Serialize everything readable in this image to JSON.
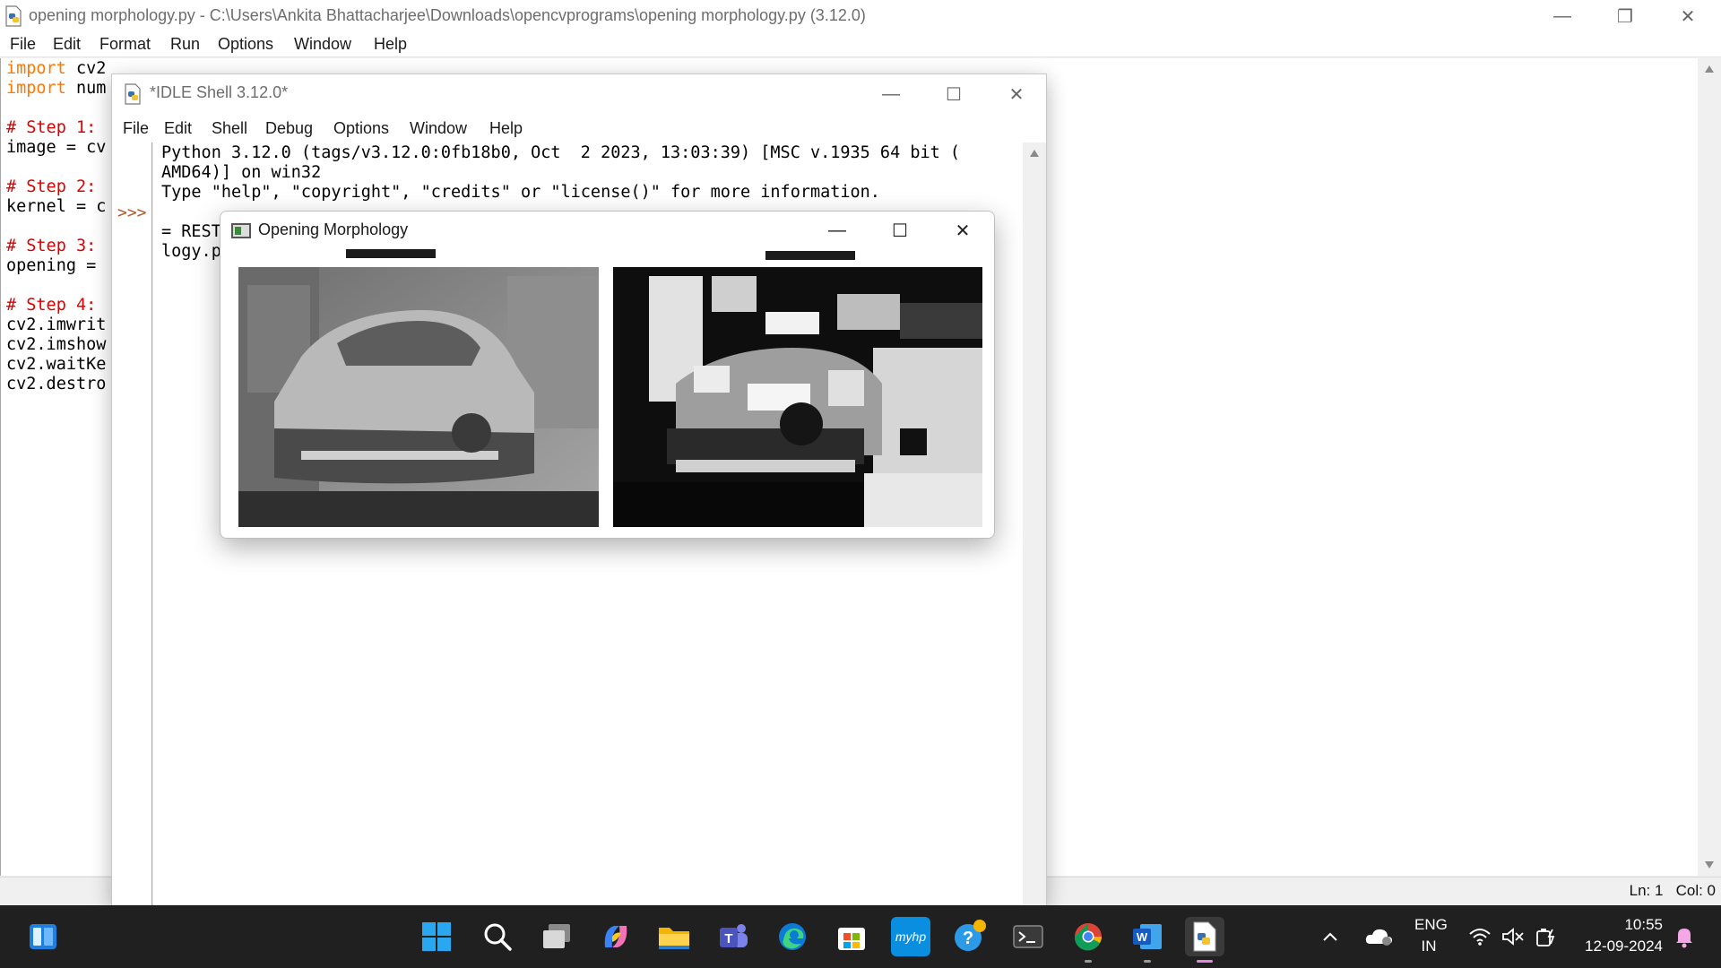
{
  "editor": {
    "title": "opening morphology.py - C:\\Users\\Ankita Bhattacharjee\\Downloads\\opencvprograms\\opening morphology.py (3.12.0)",
    "menu": [
      "File",
      "Edit",
      "Format",
      "Run",
      "Options",
      "Window",
      "Help"
    ],
    "code_lines": [
      {
        "kw": "import",
        "rest": " cv2"
      },
      {
        "kw": "import",
        "rest": " num"
      },
      {
        "kw": "",
        "rest": ""
      },
      {
        "cm": "# Step 1:"
      },
      {
        "kw": "",
        "rest": "image = cv"
      },
      {
        "kw": "",
        "rest": ""
      },
      {
        "cm": "# Step 2:"
      },
      {
        "kw": "",
        "rest": "kernel = c"
      },
      {
        "kw": "",
        "rest": ""
      },
      {
        "cm": "# Step 3:"
      },
      {
        "kw": "",
        "rest": "opening = "
      },
      {
        "kw": "",
        "rest": ""
      },
      {
        "cm": "# Step 4:"
      },
      {
        "kw": "",
        "rest": "cv2.imwrit"
      },
      {
        "kw": "",
        "rest": "cv2.imshow"
      },
      {
        "kw": "",
        "rest": "cv2.waitKe"
      },
      {
        "kw": "",
        "rest": "cv2.destro"
      }
    ],
    "status": "Ln: 1   Col: 0"
  },
  "shell": {
    "title": "*IDLE Shell 3.12.0*",
    "menu": [
      "File",
      "Edit",
      "Shell",
      "Debug",
      "Options",
      "Window",
      "Help"
    ],
    "prompt": ">>>",
    "output_lines": [
      "Python 3.12.0 (tags/v3.12.0:0fb18b0, Oct  2 2023, 13:03:39) [MSC v.1935 64 bit (",
      "AMD64)] on win32",
      "Type \"help\", \"copyright\", \"credits\" or \"license()\" for more information.",
      "",
      "= REST                                                                         ho",
      "logy.p"
    ]
  },
  "cv_window": {
    "title": "Opening Morphology",
    "images": [
      "grayscale-car",
      "morphology-opening-car"
    ]
  },
  "taskbar": {
    "apps": [
      "widgets-icon",
      "start-icon",
      "search-icon",
      "task-view-icon",
      "copilot-icon",
      "file-explorer-icon",
      "teams-icon",
      "edge-icon",
      "store-icon",
      "myhp-icon",
      "help-icon",
      "terminal-icon",
      "chrome-icon",
      "word-icon",
      "idle-icon"
    ],
    "myhp_label": "myhp",
    "lang_top": "ENG",
    "lang_bottom": "IN",
    "time": "10:55",
    "date": "12-09-2024"
  },
  "colors": {
    "keyword": "#ff7700",
    "comment": "#dd0000",
    "taskbar": "#202020",
    "prompt": "#b0562c"
  }
}
